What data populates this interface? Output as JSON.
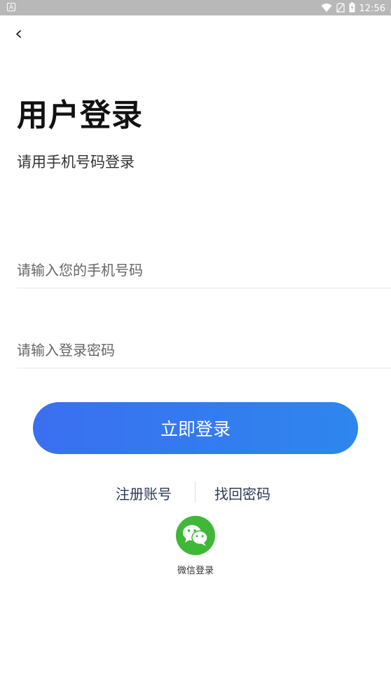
{
  "status_bar": {
    "time": "12:56",
    "icons": [
      "notification-a-icon",
      "wifi-icon",
      "no-sim-icon",
      "battery-icon"
    ]
  },
  "nav": {
    "back_icon": "chevron-left-icon"
  },
  "header": {
    "title": "用户登录",
    "subtitle": "请用手机号码登录"
  },
  "form": {
    "phone": {
      "value": "",
      "placeholder": "请输入您的手机号码"
    },
    "password": {
      "value": "",
      "placeholder": "请输入登录密码"
    },
    "submit_label": "立即登录"
  },
  "links": {
    "register": "注册账号",
    "forgot": "找回密码"
  },
  "social": {
    "wechat_label": "微信登录",
    "wechat_color": "#3fb838"
  },
  "colors": {
    "button_gradient_start": "#3a6ff0",
    "button_gradient_end": "#2e86ee"
  }
}
